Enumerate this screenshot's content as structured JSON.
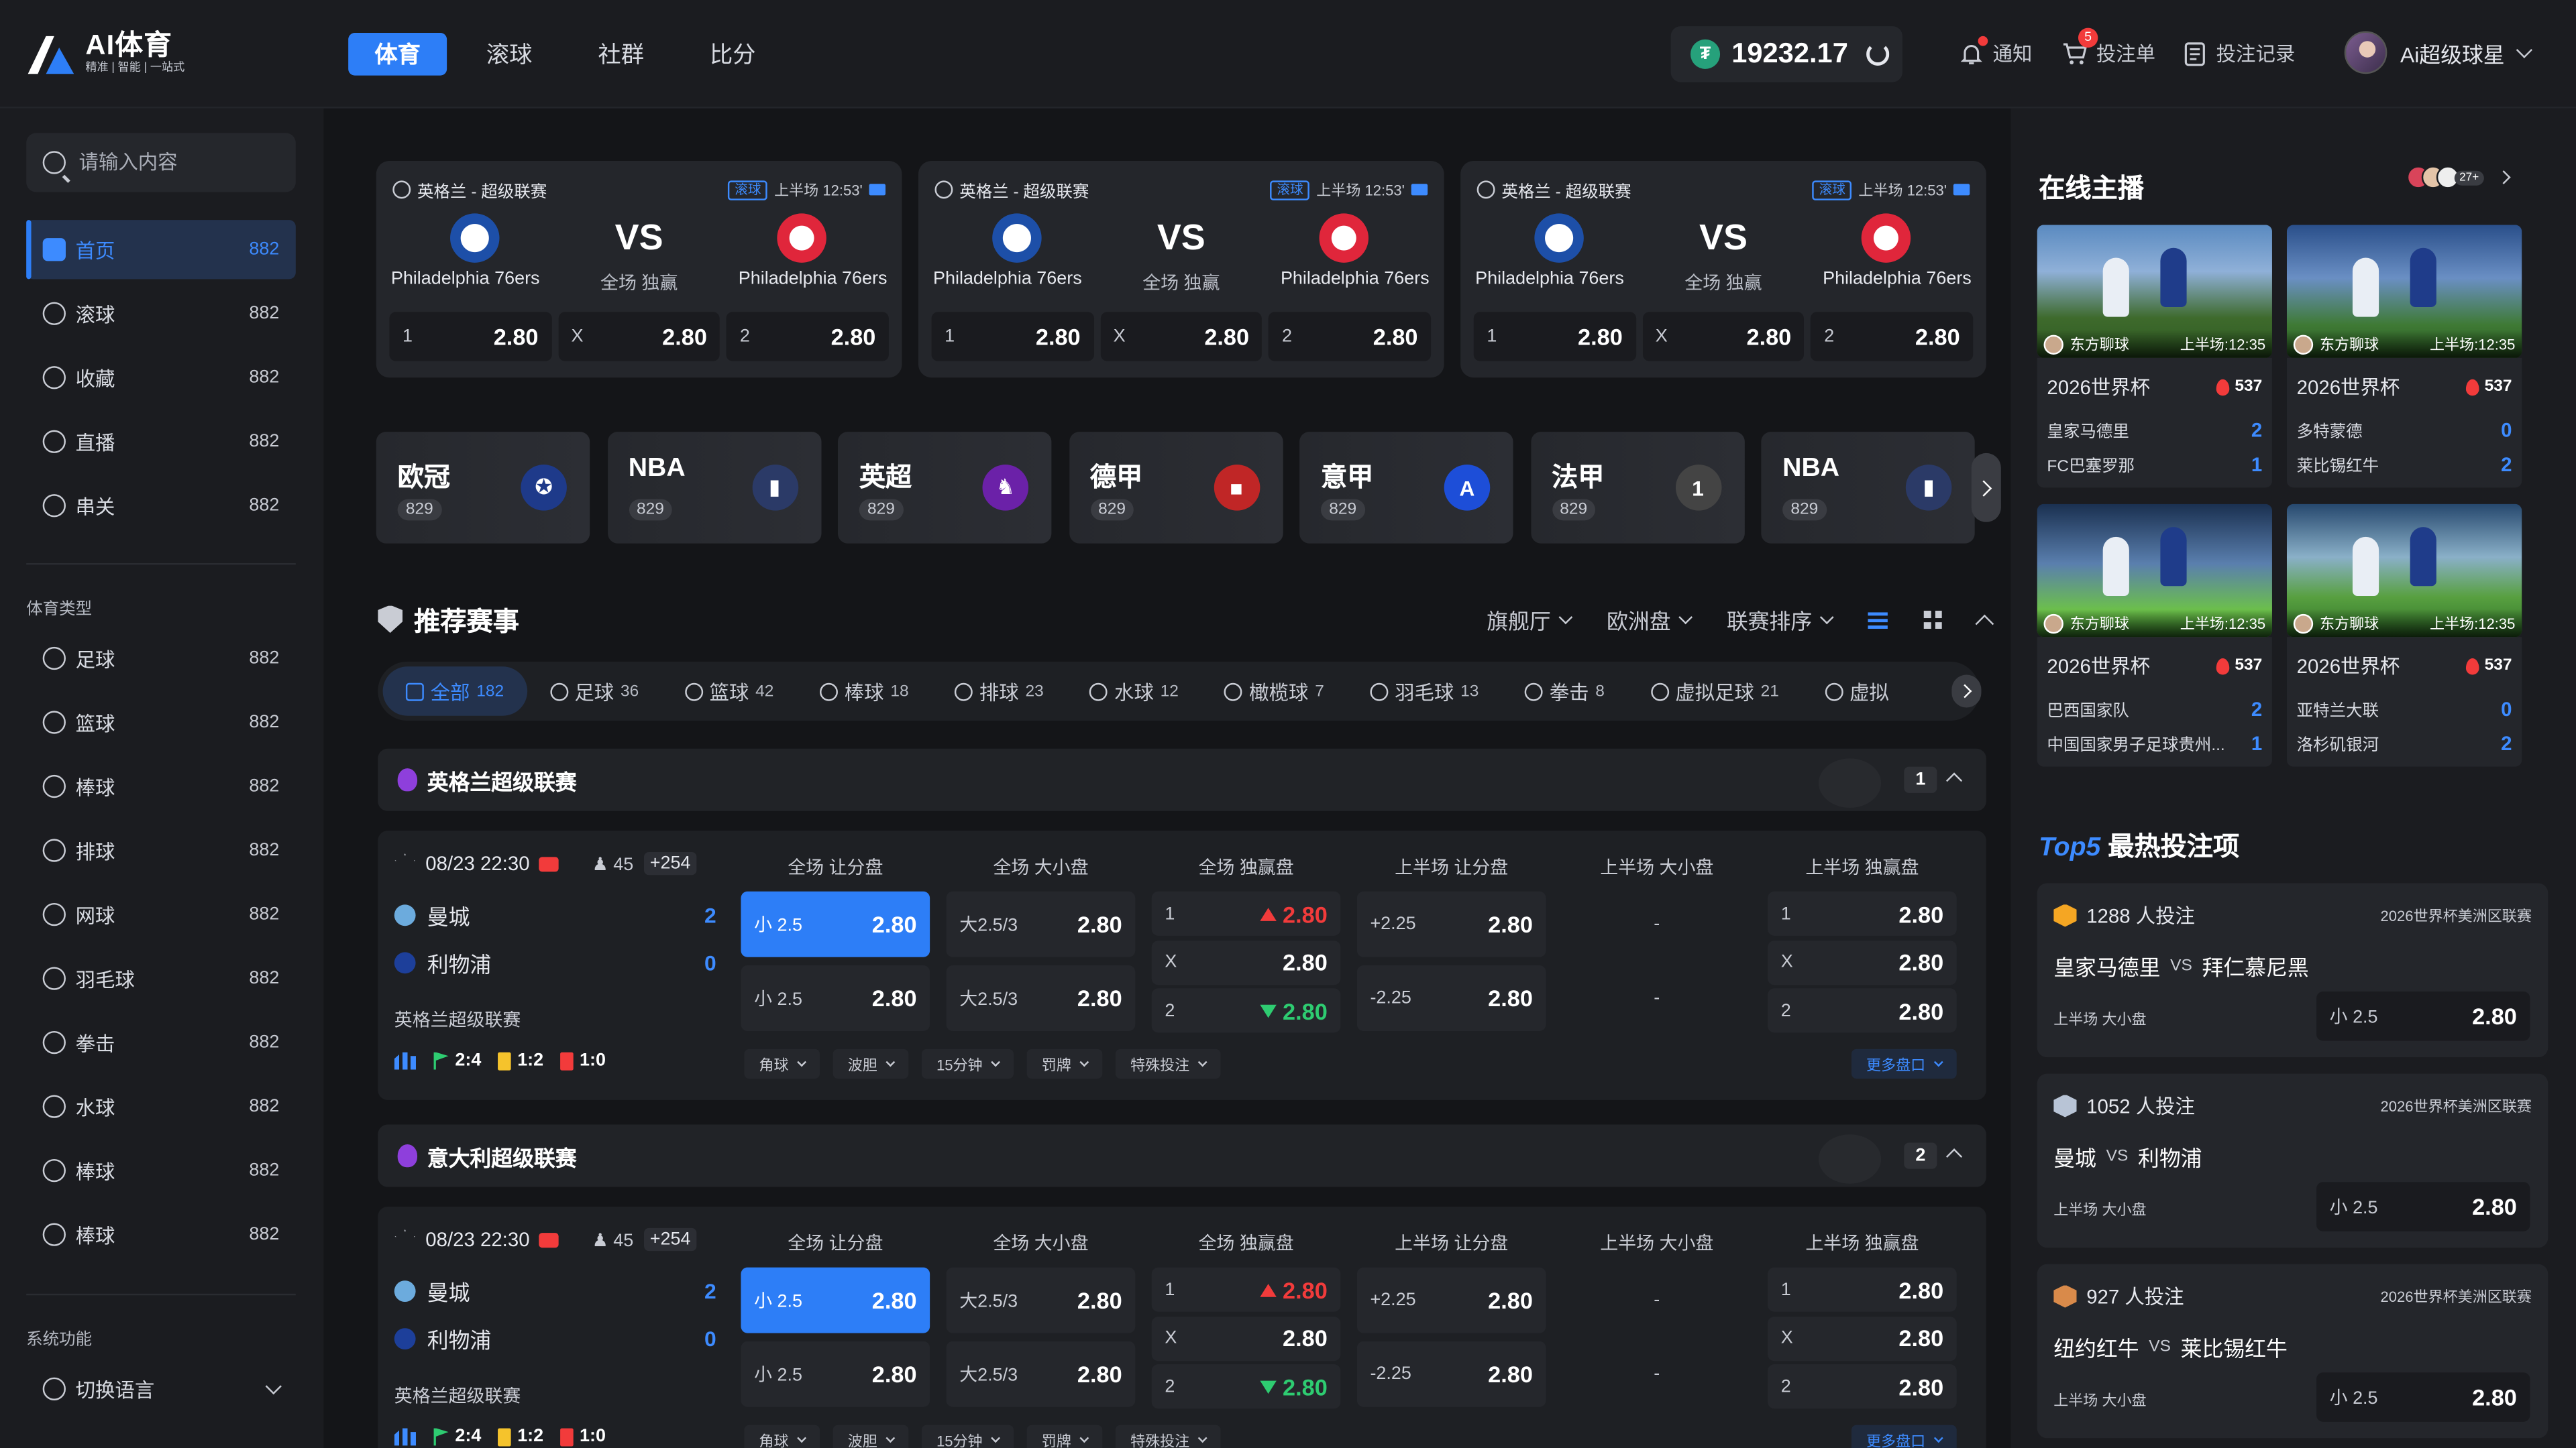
{
  "header": {
    "logo_title": "AI体育",
    "logo_sub": "精准 | 智能 | 一站式",
    "nav": [
      {
        "label": "体育",
        "active": true
      },
      {
        "label": "滚球",
        "active": false
      },
      {
        "label": "社群",
        "active": false
      },
      {
        "label": "比分",
        "active": false
      }
    ],
    "balance": "19232.17",
    "notify_label": "通知",
    "betslip_label": "投注单",
    "betslip_count": "5",
    "records_label": "投注记录",
    "username": "Ai超级球星"
  },
  "sidebar": {
    "search_placeholder": "请输入内容",
    "main_items": [
      {
        "label": "首页",
        "count": "882",
        "icon": "home-icon",
        "active": true
      },
      {
        "label": "滚球",
        "count": "882",
        "icon": "live-ball-icon",
        "active": false
      },
      {
        "label": "收藏",
        "count": "882",
        "icon": "star-icon",
        "active": false
      },
      {
        "label": "直播",
        "count": "882",
        "icon": "play-icon",
        "active": false
      },
      {
        "label": "串关",
        "count": "882",
        "icon": "parlay-icon",
        "active": false
      }
    ],
    "sports_heading": "体育类型",
    "sport_items": [
      {
        "label": "足球",
        "count": "882",
        "icon": "soccer-icon"
      },
      {
        "label": "篮球",
        "count": "882",
        "icon": "basketball-icon"
      },
      {
        "label": "棒球",
        "count": "882",
        "icon": "baseball-icon"
      },
      {
        "label": "排球",
        "count": "882",
        "icon": "volleyball-icon"
      },
      {
        "label": "网球",
        "count": "882",
        "icon": "tennis-icon"
      },
      {
        "label": "羽毛球",
        "count": "882",
        "icon": "badminton-icon"
      },
      {
        "label": "拳击",
        "count": "882",
        "icon": "boxing-icon"
      },
      {
        "label": "水球",
        "count": "882",
        "icon": "waterpolo-icon"
      },
      {
        "label": "棒球",
        "count": "882",
        "icon": "baseball-icon"
      },
      {
        "label": "棒球",
        "count": "882",
        "icon": "baseball-icon"
      }
    ],
    "system_heading": "系统功能",
    "system_items": [
      {
        "label": "切换语言",
        "icon": "globe-icon"
      }
    ]
  },
  "featured": [
    {
      "league": "英格兰 - 超级联赛",
      "tag": "滚球",
      "time": "上半场 12:53'",
      "home": "Philadelphia 76ers",
      "away": "Philadelphia 76ers",
      "vs": "VS",
      "sub": "全场 独赢",
      "odds": [
        {
          "label": "1",
          "value": "2.80"
        },
        {
          "label": "X",
          "value": "2.80"
        },
        {
          "label": "2",
          "value": "2.80"
        }
      ]
    },
    {
      "league": "英格兰 - 超级联赛",
      "tag": "滚球",
      "time": "上半场 12:53'",
      "home": "Philadelphia 76ers",
      "away": "Philadelphia 76ers",
      "vs": "VS",
      "sub": "全场 独赢",
      "odds": [
        {
          "label": "1",
          "value": "2.80"
        },
        {
          "label": "X",
          "value": "2.80"
        },
        {
          "label": "2",
          "value": "2.80"
        }
      ]
    },
    {
      "league": "英格兰 - 超级联赛",
      "tag": "滚球",
      "time": "上半场 12:53'",
      "home": "Philadelphia 76ers",
      "away": "Philadelphia 76ers",
      "vs": "VS",
      "sub": "全场 独赢",
      "odds": [
        {
          "label": "1",
          "value": "2.80"
        },
        {
          "label": "X",
          "value": "2.80"
        },
        {
          "label": "2",
          "value": "2.80"
        }
      ]
    }
  ],
  "leagues": [
    {
      "name": "欧冠",
      "count": "829",
      "icon": "champions-league-icon",
      "color": "#1e3a8a"
    },
    {
      "name": "NBA",
      "count": "829",
      "icon": "nba-icon",
      "color": "#2b3a67"
    },
    {
      "name": "英超",
      "count": "829",
      "icon": "premier-league-icon",
      "color": "#6b21a8"
    },
    {
      "name": "德甲",
      "count": "829",
      "icon": "bundesliga-icon",
      "color": "#c02626"
    },
    {
      "name": "意甲",
      "count": "829",
      "icon": "serie-a-icon",
      "color": "#1d4ed8"
    },
    {
      "name": "法甲",
      "count": "829",
      "icon": "ligue1-icon",
      "color": "#444"
    },
    {
      "name": "NBA",
      "count": "829",
      "icon": "nba-icon",
      "color": "#2b3a67"
    }
  ],
  "recommended": {
    "title": "推荐赛事",
    "filters": [
      "旗舰厅",
      "欧洲盘",
      "联赛排序"
    ],
    "tabs": [
      {
        "label": "全部",
        "count": "182",
        "active": true
      },
      {
        "label": "足球",
        "count": "36"
      },
      {
        "label": "篮球",
        "count": "42"
      },
      {
        "label": "棒球",
        "count": "18"
      },
      {
        "label": "排球",
        "count": "23"
      },
      {
        "label": "水球",
        "count": "12"
      },
      {
        "label": "橄榄球",
        "count": "7"
      },
      {
        "label": "羽毛球",
        "count": "13"
      },
      {
        "label": "拳击",
        "count": "8"
      },
      {
        "label": "虚拟足球",
        "count": "21"
      },
      {
        "label": "虚拟",
        "count": ""
      }
    ],
    "columns": [
      "全场 让分盘",
      "全场 大小盘",
      "全场 独赢盘",
      "上半场 让分盘",
      "上半场 大小盘",
      "上半场 独赢盘"
    ],
    "groups": [
      {
        "league": "英格兰超级联赛",
        "index": "1",
        "match": {
          "date": "08/23 22:30",
          "viewers": "45",
          "markets": "+254",
          "home": "曼城",
          "home_score": "2",
          "away": "利物浦",
          "away_score": "0",
          "league_name": "英格兰超级联赛",
          "stats": {
            "corners": "2:4",
            "yellow": "1:2",
            "red": "1:0"
          },
          "handicap": [
            {
              "label": "小 2.5",
              "value": "2.80"
            },
            {
              "label": "小 2.5",
              "value": "2.80"
            }
          ],
          "total": [
            {
              "label": "大2.5/3",
              "value": "2.80"
            },
            {
              "label": "大2.5/3",
              "value": "2.80"
            }
          ],
          "moneyline": [
            {
              "label": "1",
              "value": "2.80",
              "trend": "up"
            },
            {
              "label": "X",
              "value": "2.80",
              "trend": ""
            },
            {
              "label": "2",
              "value": "2.80",
              "trend": "down"
            }
          ],
          "h1_handicap": [
            {
              "label": "+2.25",
              "value": "2.80"
            },
            {
              "label": "-2.25",
              "value": "2.80"
            }
          ],
          "h1_total": [
            "-",
            "-"
          ],
          "h1_moneyline": [
            {
              "label": "1",
              "value": "2.80"
            },
            {
              "label": "X",
              "value": "2.80"
            },
            {
              "label": "2",
              "value": "2.80"
            }
          ],
          "tags": [
            "角球",
            "波胆",
            "15分钟",
            "罚牌",
            "特殊投注"
          ],
          "more": "更多盘口"
        }
      },
      {
        "league": "意大利超级联赛",
        "index": "2",
        "match": {
          "date": "08/23 22:30",
          "viewers": "45",
          "markets": "+254",
          "home": "曼城",
          "home_score": "2",
          "away": "利物浦",
          "away_score": "0",
          "league_name": "英格兰超级联赛",
          "stats": {
            "corners": "2:4",
            "yellow": "1:2",
            "red": "1:0"
          },
          "handicap": [
            {
              "label": "小 2.5",
              "value": "2.80"
            },
            {
              "label": "小 2.5",
              "value": "2.80"
            }
          ],
          "total": [
            {
              "label": "大2.5/3",
              "value": "2.80"
            },
            {
              "label": "大2.5/3",
              "value": "2.80"
            }
          ],
          "moneyline": [
            {
              "label": "1",
              "value": "2.80",
              "trend": "up"
            },
            {
              "label": "X",
              "value": "2.80",
              "trend": ""
            },
            {
              "label": "2",
              "value": "2.80",
              "trend": "down"
            }
          ],
          "h1_handicap": [
            {
              "label": "+2.25",
              "value": "2.80"
            },
            {
              "label": "-2.25",
              "value": "2.80"
            }
          ],
          "h1_total": [
            "-",
            "-"
          ],
          "h1_moneyline": [
            {
              "label": "1",
              "value": "2.80"
            },
            {
              "label": "X",
              "value": "2.80"
            },
            {
              "label": "2",
              "value": "2.80"
            }
          ],
          "tags": [
            "角球",
            "波胆",
            "15分钟",
            "罚牌",
            "特殊投注"
          ],
          "more": "更多盘口"
        }
      }
    ]
  },
  "right": {
    "streams_title": "在线主播",
    "streams_more": "27+",
    "streams": [
      {
        "host": "东方聊球",
        "time": "上半场:12:35",
        "event": "2026世界杯",
        "hot": "537",
        "home": "皇家马德里",
        "home_score": "2",
        "away": "FC巴塞罗那",
        "away_score": "1",
        "style": "s1"
      },
      {
        "host": "东方聊球",
        "time": "上半场:12:35",
        "event": "2026世界杯",
        "hot": "537",
        "home": "多特蒙德",
        "home_score": "0",
        "away": "莱比锡红牛",
        "away_score": "2",
        "style": "s2"
      },
      {
        "host": "东方聊球",
        "time": "上半场:12:35",
        "event": "2026世界杯",
        "hot": "537",
        "home": "巴西国家队",
        "home_score": "2",
        "away": "中国国家男子足球贵州...",
        "away_score": "1",
        "style": "s3"
      },
      {
        "host": "东方聊球",
        "time": "上半场:12:35",
        "event": "2026世界杯",
        "hot": "537",
        "home": "亚特兰大联",
        "home_score": "0",
        "away": "洛杉矶银河",
        "away_score": "2",
        "style": "s4"
      }
    ],
    "top_title_a": "Top5",
    "top_title_b": "最热投注项",
    "top_bets": [
      {
        "count": "1288 人投注",
        "league": "2026世界杯美洲区联赛",
        "home": "皇家马德里",
        "vs": "VS",
        "away": "拜仁慕尼黑",
        "type": "上半场 大小盘",
        "pick": "小 2.5",
        "odds": "2.80",
        "color": "#f5a623"
      },
      {
        "count": "1052 人投注",
        "league": "2026世界杯美洲区联赛",
        "home": "曼城",
        "vs": "VS",
        "away": "利物浦",
        "type": "上半场 大小盘",
        "pick": "小 2.5",
        "odds": "2.80",
        "color": "#b8c4d6"
      },
      {
        "count": "927 人投注",
        "league": "2026世界杯美洲区联赛",
        "home": "纽约红牛",
        "vs": "VS",
        "away": "莱比锡红牛",
        "type": "上半场 大小盘",
        "pick": "小 2.5",
        "odds": "2.80",
        "color": "#d98a4a"
      }
    ]
  }
}
